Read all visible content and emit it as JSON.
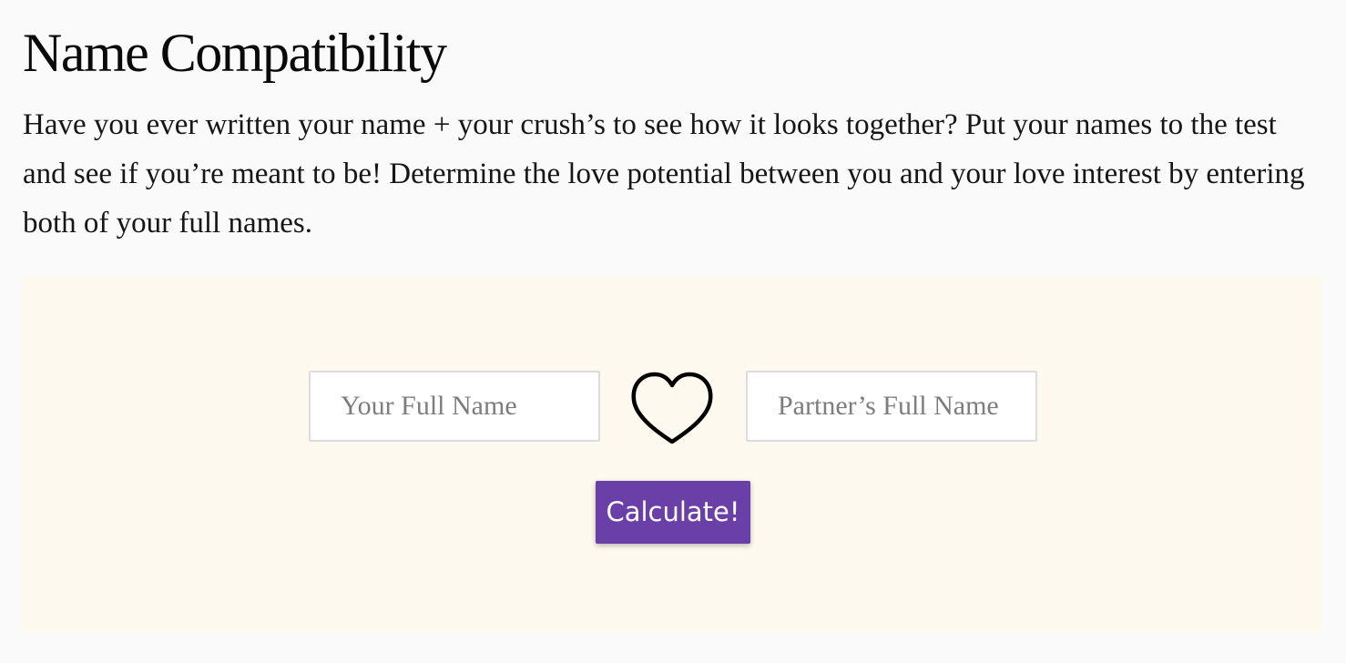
{
  "page": {
    "title": "Name Compatibility",
    "intro": "Have you ever written your name + your crush’s to see how it looks together? Put your names to the test and see if you’re meant to be! Determine the love potential between you and your love interest by entering both of your full names."
  },
  "calculator": {
    "your_name_placeholder": "Your Full Name",
    "partner_name_placeholder": "Partner’s Full Name",
    "your_name_value": "",
    "partner_name_value": "",
    "heart_icon": "heart-outline-icon",
    "calculate_label": "Calculate!"
  },
  "colors": {
    "page_background": "#fafafa",
    "panel_background": "#fdf9ee",
    "button_background": "#6b3fa8",
    "button_text": "#ffffff"
  }
}
